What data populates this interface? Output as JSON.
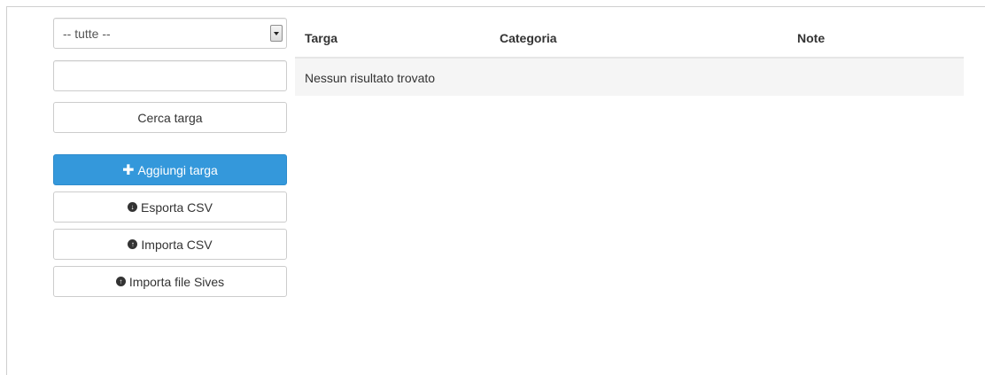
{
  "filters": {
    "category_select_value": "-- tutte --",
    "plate_input_value": "",
    "plate_input_placeholder": ""
  },
  "actions": {
    "search_label": "Cerca targa",
    "add_label": "Aggiungi targa",
    "export_csv_label": "Esporta CSV",
    "import_csv_label": "Importa CSV",
    "import_sives_label": "Importa file Sives"
  },
  "icons": {
    "add": "plus-icon",
    "export": "circle-arrow-down-icon",
    "import": "circle-arrow-up-icon"
  },
  "table": {
    "columns": [
      "Targa",
      "Categoria",
      "Note"
    ],
    "empty_message": "Nessun risultato trovato"
  },
  "colors": {
    "primary": "#3498db",
    "empty_row_bg": "#f5f5f5"
  }
}
